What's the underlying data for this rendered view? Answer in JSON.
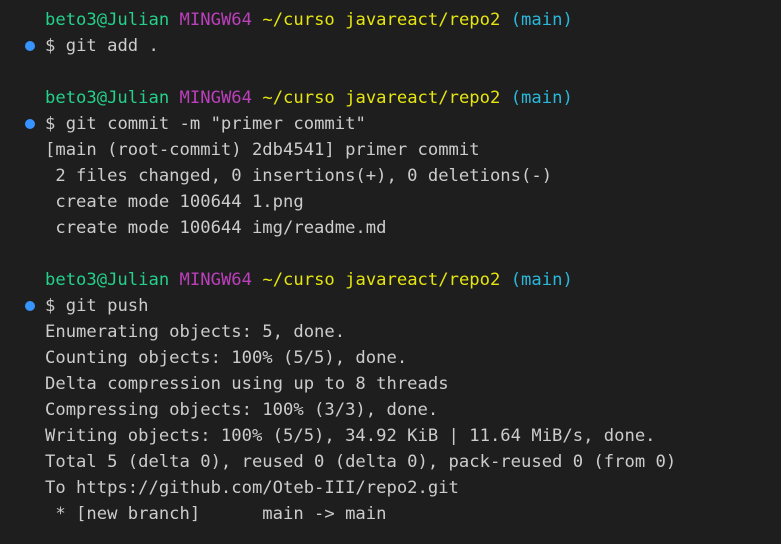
{
  "colors": {
    "background": "#1e1e1e",
    "text": "#cccccc",
    "user": "#23d18b",
    "host": "#bc3fbc",
    "path": "#e5e510",
    "branch": "#29b8db",
    "marker": "#3794ff"
  },
  "prompt": {
    "user": "beto3@Julian",
    "host": "MINGW64",
    "path": "~/curso javareact/repo2",
    "branch": "(main)",
    "symbol": "$"
  },
  "blocks": [
    {
      "command": "git add .",
      "output": []
    },
    {
      "command": "git commit -m \"primer commit\"",
      "output": [
        "[main (root-commit) 2db4541] primer commit",
        " 2 files changed, 0 insertions(+), 0 deletions(-)",
        " create mode 100644 1.png",
        " create mode 100644 img/readme.md"
      ]
    },
    {
      "command": "git push",
      "output": [
        "Enumerating objects: 5, done.",
        "Counting objects: 100% (5/5), done.",
        "Delta compression using up to 8 threads",
        "Compressing objects: 100% (3/3), done.",
        "Writing objects: 100% (5/5), 34.92 KiB | 11.64 MiB/s, done.",
        "Total 5 (delta 0), reused 0 (delta 0), pack-reused 0 (from 0)",
        "To https://github.com/Oteb-III/repo2.git",
        " * [new branch]      main -> main"
      ]
    }
  ]
}
